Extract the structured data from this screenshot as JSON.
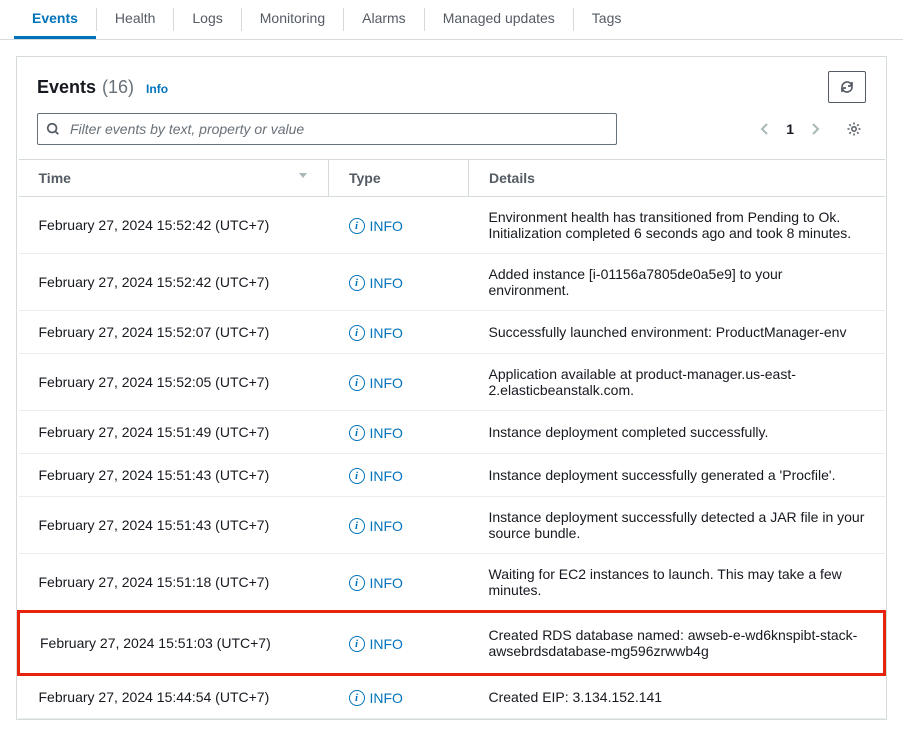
{
  "tabs": [
    {
      "label": "Events",
      "active": true
    },
    {
      "label": "Health"
    },
    {
      "label": "Logs"
    },
    {
      "label": "Monitoring"
    },
    {
      "label": "Alarms"
    },
    {
      "label": "Managed updates"
    },
    {
      "label": "Tags"
    }
  ],
  "panel": {
    "title": "Events",
    "count": "(16)",
    "info_label": "Info"
  },
  "search": {
    "placeholder": "Filter events by text, property or value"
  },
  "pager": {
    "page": "1"
  },
  "columns": {
    "time": "Time",
    "type": "Type",
    "details": "Details"
  },
  "type_info": "INFO",
  "events": [
    {
      "time": "February 27, 2024 15:52:42 (UTC+7)",
      "type": "INFO",
      "details": "Environment health has transitioned from Pending to Ok. Initialization completed 6 seconds ago and took 8 minutes."
    },
    {
      "time": "February 27, 2024 15:52:42 (UTC+7)",
      "type": "INFO",
      "details": "Added instance [i-01156a7805de0a5e9] to your environment."
    },
    {
      "time": "February 27, 2024 15:52:07 (UTC+7)",
      "type": "INFO",
      "details": "Successfully launched environment: ProductManager-env"
    },
    {
      "time": "February 27, 2024 15:52:05 (UTC+7)",
      "type": "INFO",
      "details": "Application available at product-manager.us-east-2.elasticbeanstalk.com."
    },
    {
      "time": "February 27, 2024 15:51:49 (UTC+7)",
      "type": "INFO",
      "details": "Instance deployment completed successfully."
    },
    {
      "time": "February 27, 2024 15:51:43 (UTC+7)",
      "type": "INFO",
      "details": "Instance deployment successfully generated a 'Procfile'."
    },
    {
      "time": "February 27, 2024 15:51:43 (UTC+7)",
      "type": "INFO",
      "details": "Instance deployment successfully detected a JAR file in your source bundle."
    },
    {
      "time": "February 27, 2024 15:51:18 (UTC+7)",
      "type": "INFO",
      "details": "Waiting for EC2 instances to launch. This may take a few minutes."
    },
    {
      "time": "February 27, 2024 15:51:03 (UTC+7)",
      "type": "INFO",
      "details": "Created RDS database named: awseb-e-wd6knspibt-stack-awsebrdsdatabase-mg596zrwwb4g",
      "highlight": true
    },
    {
      "time": "February 27, 2024 15:44:54 (UTC+7)",
      "type": "INFO",
      "details": "Created EIP: 3.134.152.141"
    }
  ]
}
